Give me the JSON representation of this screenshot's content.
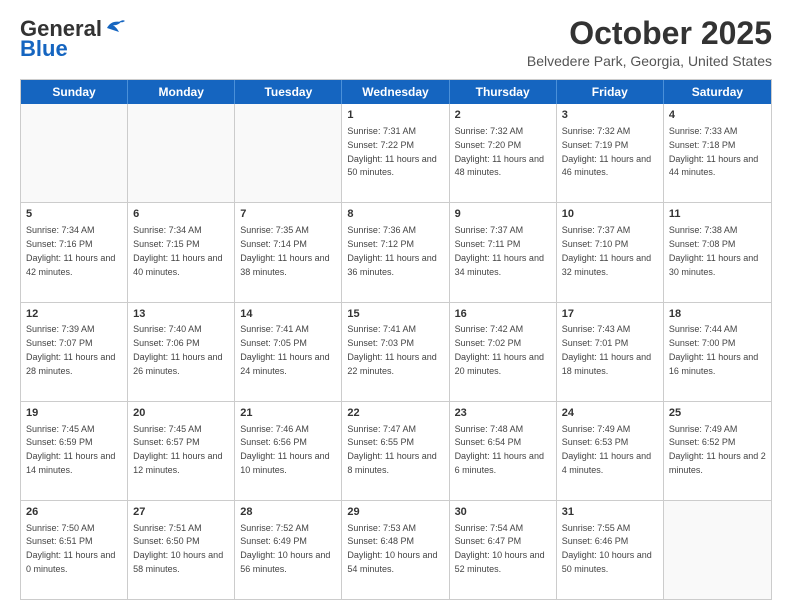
{
  "header": {
    "logo_general": "General",
    "logo_blue": "Blue",
    "month_title": "October 2025",
    "location": "Belvedere Park, Georgia, United States"
  },
  "weekdays": [
    "Sunday",
    "Monday",
    "Tuesday",
    "Wednesday",
    "Thursday",
    "Friday",
    "Saturday"
  ],
  "rows": [
    [
      {
        "day": "",
        "info": ""
      },
      {
        "day": "",
        "info": ""
      },
      {
        "day": "",
        "info": ""
      },
      {
        "day": "1",
        "info": "Sunrise: 7:31 AM\nSunset: 7:22 PM\nDaylight: 11 hours and 50 minutes."
      },
      {
        "day": "2",
        "info": "Sunrise: 7:32 AM\nSunset: 7:20 PM\nDaylight: 11 hours and 48 minutes."
      },
      {
        "day": "3",
        "info": "Sunrise: 7:32 AM\nSunset: 7:19 PM\nDaylight: 11 hours and 46 minutes."
      },
      {
        "day": "4",
        "info": "Sunrise: 7:33 AM\nSunset: 7:18 PM\nDaylight: 11 hours and 44 minutes."
      }
    ],
    [
      {
        "day": "5",
        "info": "Sunrise: 7:34 AM\nSunset: 7:16 PM\nDaylight: 11 hours and 42 minutes."
      },
      {
        "day": "6",
        "info": "Sunrise: 7:34 AM\nSunset: 7:15 PM\nDaylight: 11 hours and 40 minutes."
      },
      {
        "day": "7",
        "info": "Sunrise: 7:35 AM\nSunset: 7:14 PM\nDaylight: 11 hours and 38 minutes."
      },
      {
        "day": "8",
        "info": "Sunrise: 7:36 AM\nSunset: 7:12 PM\nDaylight: 11 hours and 36 minutes."
      },
      {
        "day": "9",
        "info": "Sunrise: 7:37 AM\nSunset: 7:11 PM\nDaylight: 11 hours and 34 minutes."
      },
      {
        "day": "10",
        "info": "Sunrise: 7:37 AM\nSunset: 7:10 PM\nDaylight: 11 hours and 32 minutes."
      },
      {
        "day": "11",
        "info": "Sunrise: 7:38 AM\nSunset: 7:08 PM\nDaylight: 11 hours and 30 minutes."
      }
    ],
    [
      {
        "day": "12",
        "info": "Sunrise: 7:39 AM\nSunset: 7:07 PM\nDaylight: 11 hours and 28 minutes."
      },
      {
        "day": "13",
        "info": "Sunrise: 7:40 AM\nSunset: 7:06 PM\nDaylight: 11 hours and 26 minutes."
      },
      {
        "day": "14",
        "info": "Sunrise: 7:41 AM\nSunset: 7:05 PM\nDaylight: 11 hours and 24 minutes."
      },
      {
        "day": "15",
        "info": "Sunrise: 7:41 AM\nSunset: 7:03 PM\nDaylight: 11 hours and 22 minutes."
      },
      {
        "day": "16",
        "info": "Sunrise: 7:42 AM\nSunset: 7:02 PM\nDaylight: 11 hours and 20 minutes."
      },
      {
        "day": "17",
        "info": "Sunrise: 7:43 AM\nSunset: 7:01 PM\nDaylight: 11 hours and 18 minutes."
      },
      {
        "day": "18",
        "info": "Sunrise: 7:44 AM\nSunset: 7:00 PM\nDaylight: 11 hours and 16 minutes."
      }
    ],
    [
      {
        "day": "19",
        "info": "Sunrise: 7:45 AM\nSunset: 6:59 PM\nDaylight: 11 hours and 14 minutes."
      },
      {
        "day": "20",
        "info": "Sunrise: 7:45 AM\nSunset: 6:57 PM\nDaylight: 11 hours and 12 minutes."
      },
      {
        "day": "21",
        "info": "Sunrise: 7:46 AM\nSunset: 6:56 PM\nDaylight: 11 hours and 10 minutes."
      },
      {
        "day": "22",
        "info": "Sunrise: 7:47 AM\nSunset: 6:55 PM\nDaylight: 11 hours and 8 minutes."
      },
      {
        "day": "23",
        "info": "Sunrise: 7:48 AM\nSunset: 6:54 PM\nDaylight: 11 hours and 6 minutes."
      },
      {
        "day": "24",
        "info": "Sunrise: 7:49 AM\nSunset: 6:53 PM\nDaylight: 11 hours and 4 minutes."
      },
      {
        "day": "25",
        "info": "Sunrise: 7:49 AM\nSunset: 6:52 PM\nDaylight: 11 hours and 2 minutes."
      }
    ],
    [
      {
        "day": "26",
        "info": "Sunrise: 7:50 AM\nSunset: 6:51 PM\nDaylight: 11 hours and 0 minutes."
      },
      {
        "day": "27",
        "info": "Sunrise: 7:51 AM\nSunset: 6:50 PM\nDaylight: 10 hours and 58 minutes."
      },
      {
        "day": "28",
        "info": "Sunrise: 7:52 AM\nSunset: 6:49 PM\nDaylight: 10 hours and 56 minutes."
      },
      {
        "day": "29",
        "info": "Sunrise: 7:53 AM\nSunset: 6:48 PM\nDaylight: 10 hours and 54 minutes."
      },
      {
        "day": "30",
        "info": "Sunrise: 7:54 AM\nSunset: 6:47 PM\nDaylight: 10 hours and 52 minutes."
      },
      {
        "day": "31",
        "info": "Sunrise: 7:55 AM\nSunset: 6:46 PM\nDaylight: 10 hours and 50 minutes."
      },
      {
        "day": "",
        "info": ""
      }
    ]
  ]
}
